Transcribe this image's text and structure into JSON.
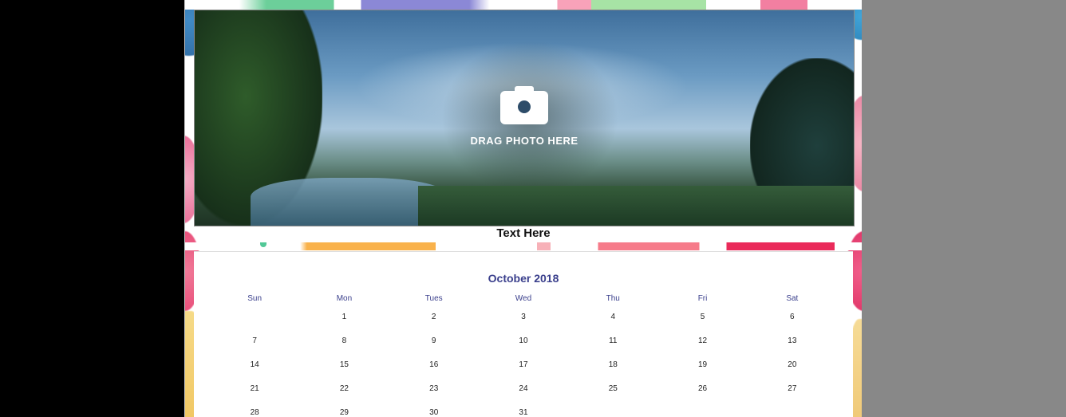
{
  "photo": {
    "upload_prompt": "DRAG PHOTO HERE"
  },
  "caption": "Text Here",
  "calendar": {
    "month": "October 2018",
    "weekdays": [
      "Sun",
      "Mon",
      "Tues",
      "Wed",
      "Thu",
      "Fri",
      "Sat"
    ],
    "weeks": [
      [
        "",
        "1",
        "2",
        "3",
        "4",
        "5",
        "6"
      ],
      [
        "7",
        "8",
        "9",
        "10",
        "11",
        "12",
        "13"
      ],
      [
        "14",
        "15",
        "16",
        "17",
        "18",
        "19",
        "20"
      ],
      [
        "21",
        "22",
        "23",
        "24",
        "25",
        "26",
        "27"
      ],
      [
        "28",
        "29",
        "30",
        "31",
        "",
        "",
        ""
      ]
    ]
  },
  "icons": {
    "upload": "camera-icon"
  }
}
